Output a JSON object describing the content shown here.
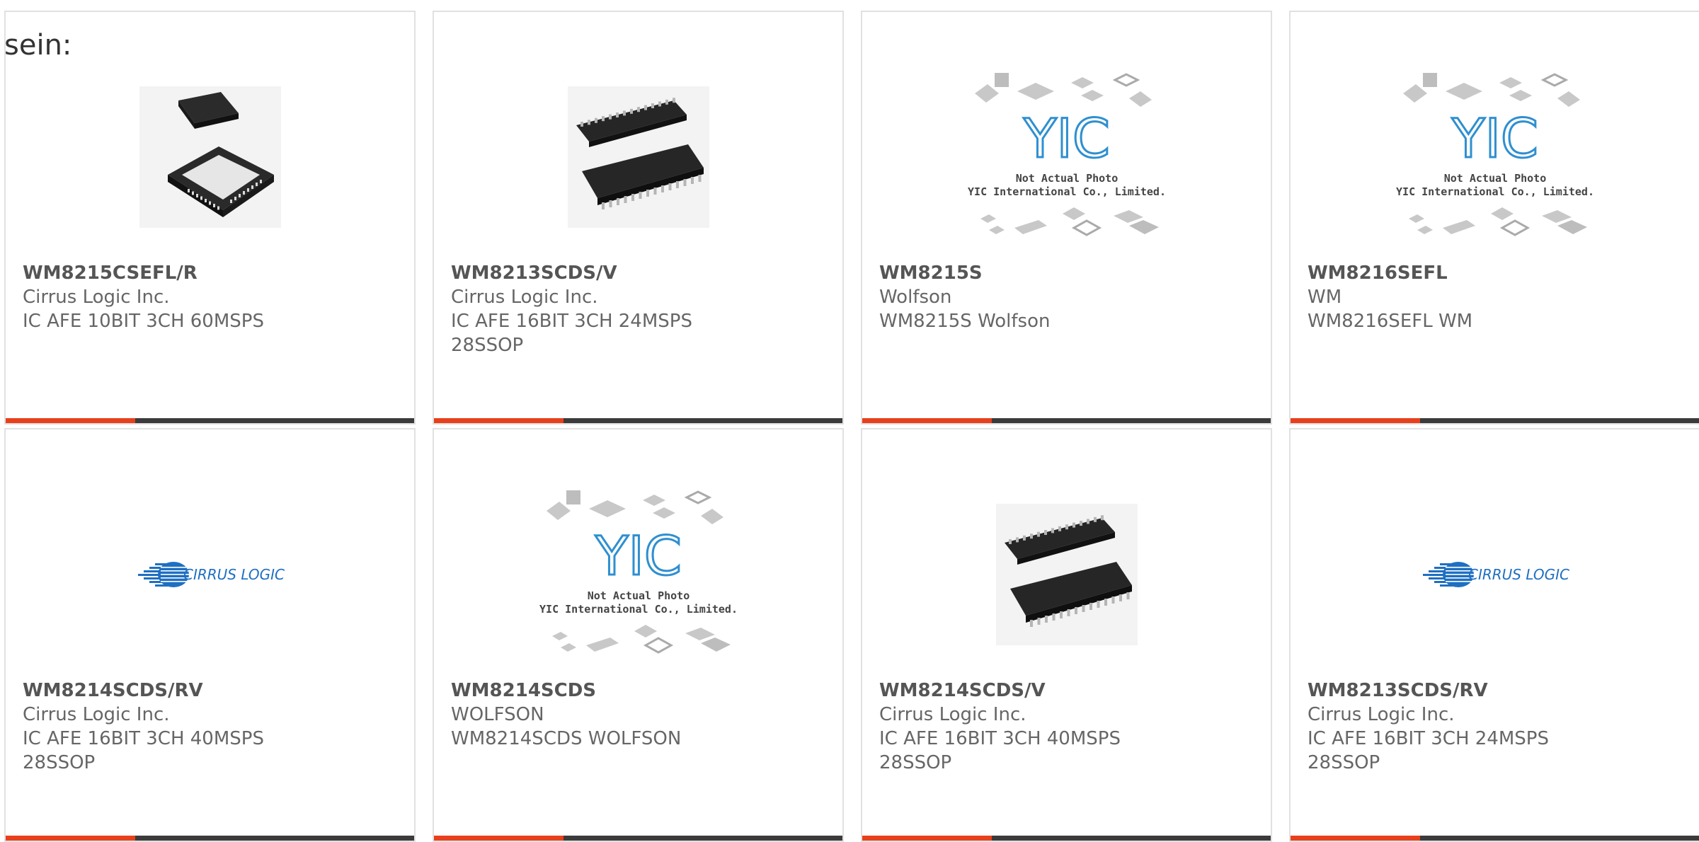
{
  "intro_text": "sein:",
  "colors": {
    "accent": "#e8401c",
    "bar": "#3b3b3b",
    "border": "#e1e1e1",
    "text": "#666666"
  },
  "products": [
    {
      "part": "WM8215CSEFL/R",
      "maker": "Cirrus Logic Inc.",
      "desc": [
        "IC AFE 10BIT 3CH 60MSPS"
      ],
      "image": "qfn-chip"
    },
    {
      "part": "WM8213SCDS/V",
      "maker": "Cirrus Logic Inc.",
      "desc": [
        "IC AFE 16BIT 3CH 24MSPS",
        "28SSOP"
      ],
      "image": "ssop-chip"
    },
    {
      "part": "WM8215S",
      "maker": "Wolfson",
      "desc": [
        "WM8215S Wolfson"
      ],
      "image": "yic-placeholder"
    },
    {
      "part": "WM8216SEFL",
      "maker": "WM",
      "desc": [
        "WM8216SEFL WM"
      ],
      "image": "yic-placeholder"
    },
    {
      "part": "WM8214SCDS/RV",
      "maker": "Cirrus Logic Inc.",
      "desc": [
        "IC AFE 16BIT 3CH 40MSPS",
        "28SSOP"
      ],
      "image": "cirrus-logo"
    },
    {
      "part": "WM8214SCDS",
      "maker": "WOLFSON",
      "desc": [
        "WM8214SCDS WOLFSON"
      ],
      "image": "yic-placeholder"
    },
    {
      "part": "WM8214SCDS/V",
      "maker": "Cirrus Logic Inc.",
      "desc": [
        "IC AFE 16BIT 3CH 40MSPS",
        "28SSOP"
      ],
      "image": "ssop-chip"
    },
    {
      "part": "WM8213SCDS/RV",
      "maker": "Cirrus Logic Inc.",
      "desc": [
        "IC AFE 16BIT 3CH 24MSPS",
        "28SSOP"
      ],
      "image": "cirrus-logo"
    }
  ],
  "placeholder": {
    "brand": "YIC",
    "line1": "Not Actual Photo",
    "line2": "YIC International Co., Limited."
  },
  "cirrus_logo_text": "CIRRUS LOGIC"
}
